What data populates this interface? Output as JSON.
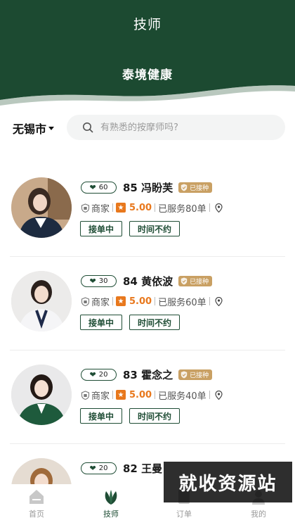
{
  "header": {
    "title": "技师",
    "brand": "泰境健康",
    "bg_color": "#1c4a31"
  },
  "search": {
    "city": "无锡市",
    "placeholder": "有熟悉的按摩师吗?"
  },
  "technicians": [
    {
      "likes": "60",
      "number_name": "85 冯盼芙",
      "vaccine_label": "已接种",
      "shop_label": "商家",
      "rating": "5.00",
      "orders": "已服务80单",
      "tag_accept": "接单中",
      "tag_time": "时间不约"
    },
    {
      "likes": "30",
      "number_name": "84 黄依波",
      "vaccine_label": "已接种",
      "shop_label": "商家",
      "rating": "5.00",
      "orders": "已服务60单",
      "tag_accept": "接单中",
      "tag_time": "时间不约"
    },
    {
      "likes": "20",
      "number_name": "83 霍念之",
      "vaccine_label": "已接种",
      "shop_label": "商家",
      "rating": "5.00",
      "orders": "已服务40单",
      "tag_accept": "接单中",
      "tag_time": "时间不约"
    },
    {
      "likes": "20",
      "number_name": "82 王曼",
      "vaccine_label": "",
      "shop_label": "",
      "rating": "",
      "orders": "",
      "tag_accept": "",
      "tag_time": ""
    }
  ],
  "tabbar": [
    {
      "label": "首页",
      "icon": "home-icon"
    },
    {
      "label": "技师",
      "icon": "leaf-icon"
    },
    {
      "label": "订单",
      "icon": "order-icon"
    },
    {
      "label": "我的",
      "icon": "user-icon"
    }
  ],
  "watermark": "就收资源站",
  "colors": {
    "accent": "#1f4d35",
    "gold": "#c9a063",
    "rating": "#e8781d"
  }
}
